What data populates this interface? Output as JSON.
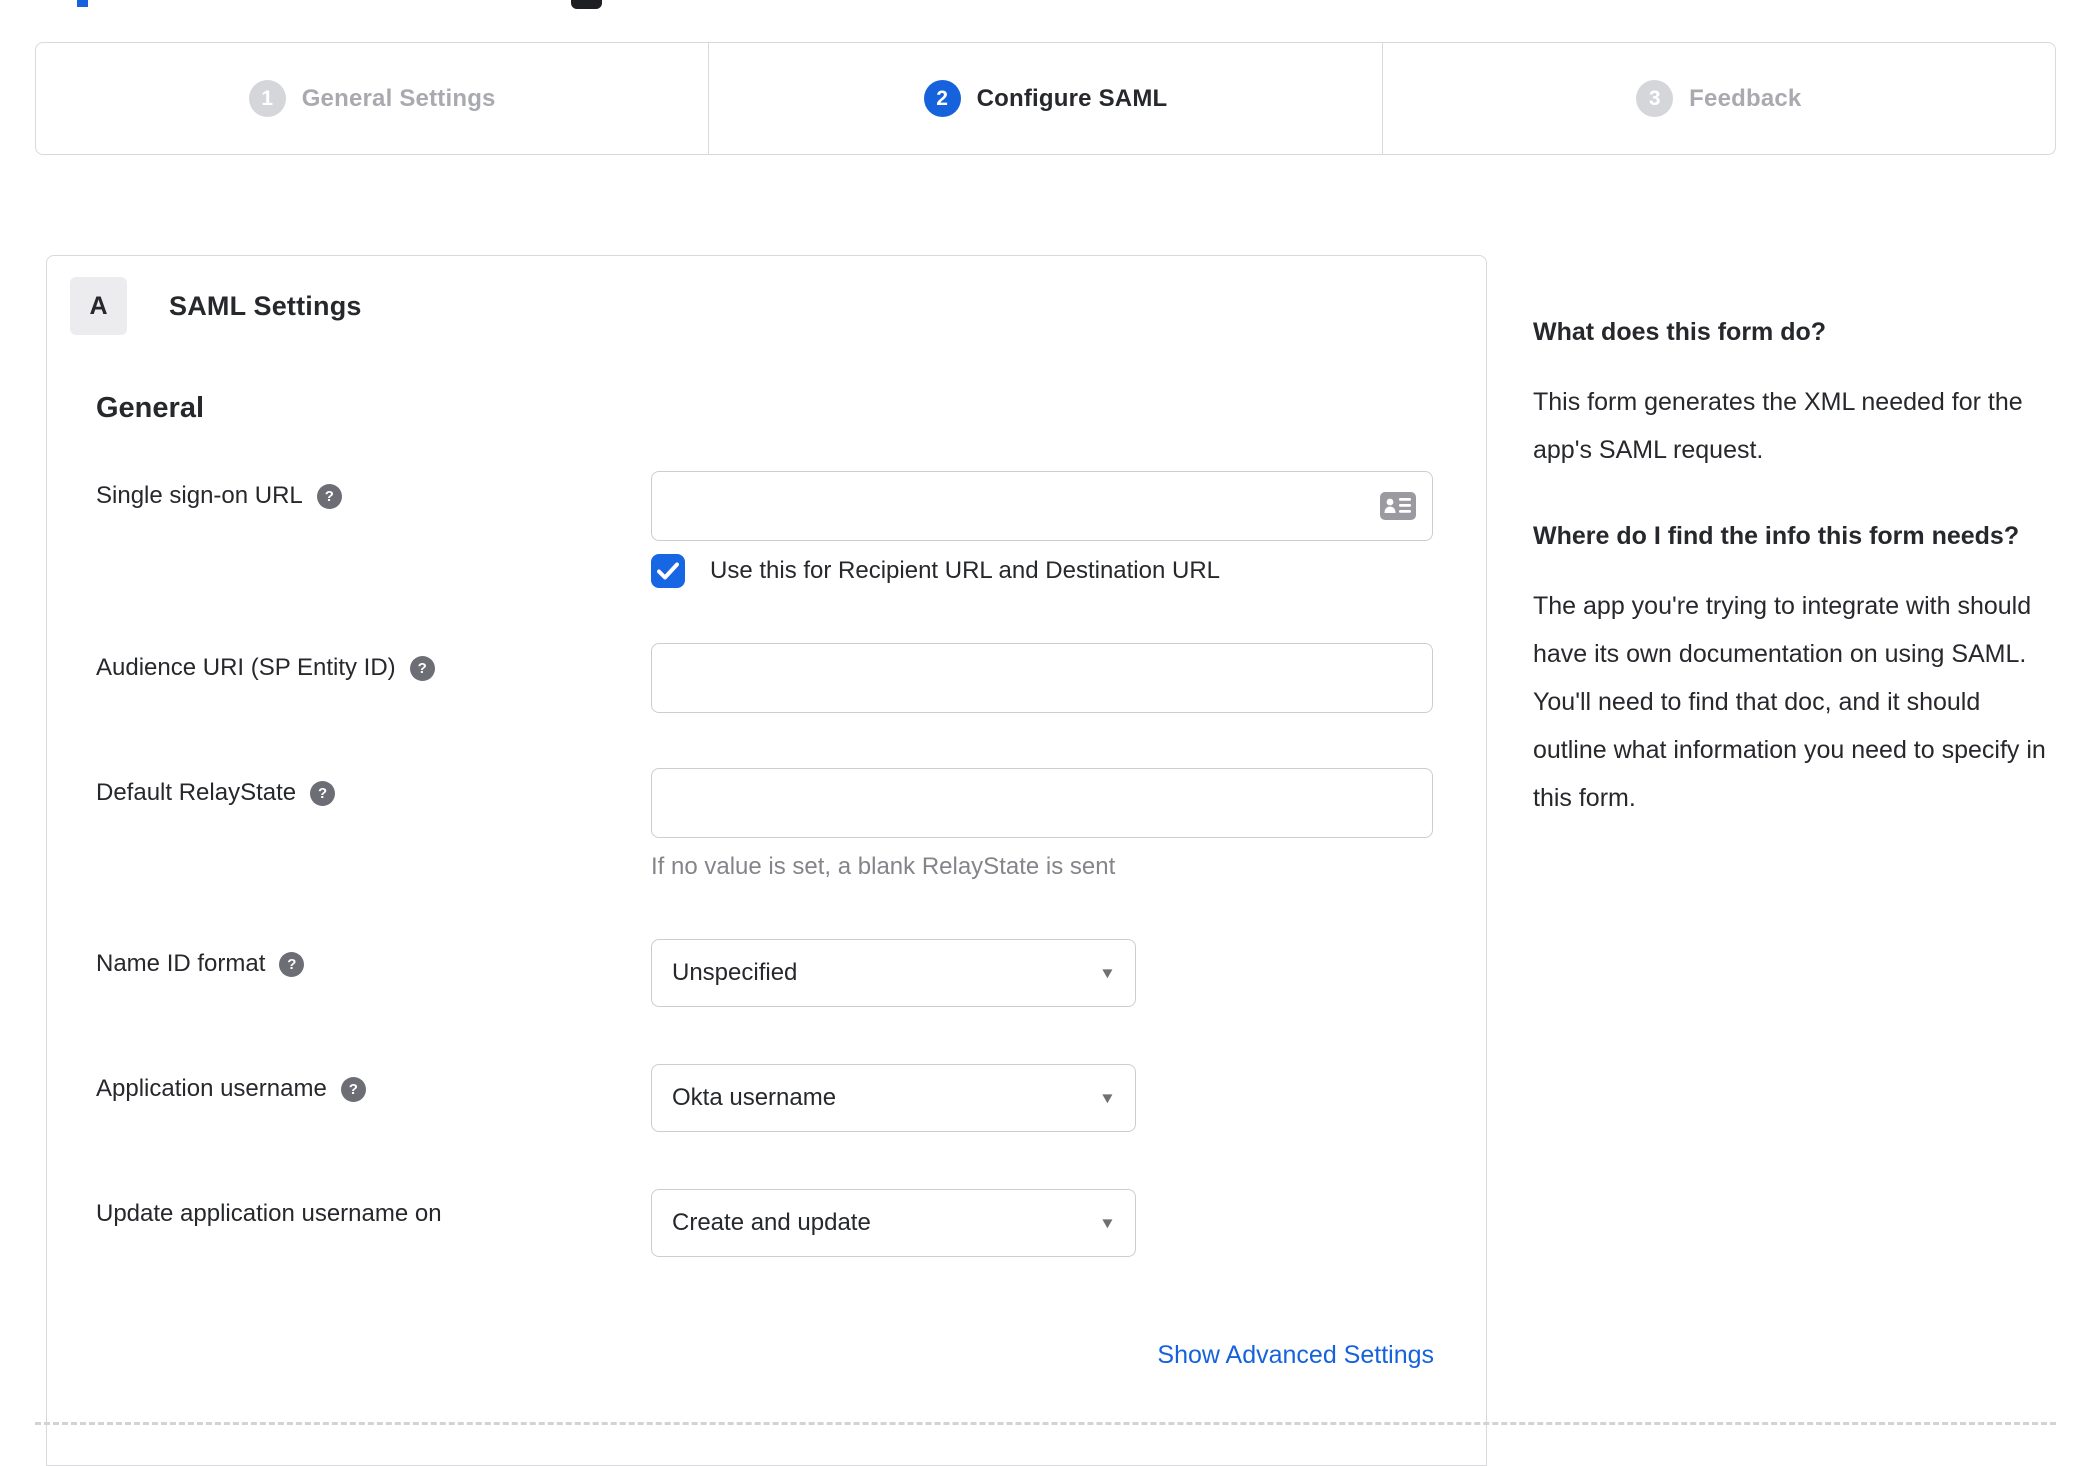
{
  "stepper": {
    "steps": [
      {
        "number": "1",
        "label": "General Settings",
        "state": "inactive"
      },
      {
        "number": "2",
        "label": "Configure SAML",
        "state": "active"
      },
      {
        "number": "3",
        "label": "Feedback",
        "state": "inactive"
      }
    ]
  },
  "panel": {
    "badge": "A",
    "title": "SAML Settings",
    "section_heading": "General",
    "fields": {
      "sso_url": {
        "label": "Single sign-on URL",
        "value": "",
        "placeholder": ""
      },
      "sso_checkbox": {
        "label": "Use this for Recipient URL and Destination URL",
        "checked": true
      },
      "audience": {
        "label": "Audience URI (SP Entity ID)",
        "value": "",
        "placeholder": ""
      },
      "relay": {
        "label": "Default RelayState",
        "value": "",
        "placeholder": "",
        "hint": "If no value is set, a blank RelayState is sent"
      },
      "name_id": {
        "label": "Name ID format",
        "value": "Unspecified"
      },
      "app_user": {
        "label": "Application username",
        "value": "Okta username"
      },
      "update_user": {
        "label": "Update application username on",
        "value": "Create and update"
      }
    },
    "advanced_link": "Show Advanced Settings"
  },
  "sidebar": {
    "sections": [
      {
        "heading": "What does this form do?",
        "body": "This form generates the XML needed for the app's SAML request."
      },
      {
        "heading": "Where do I find the info this form needs?",
        "body": "The app you're trying to integrate with should have its own documentation on using SAML. You'll need to find that doc, and it should outline what information you need to specify in this form."
      }
    ]
  },
  "icons": {
    "help": "?",
    "dropdown_caret": "▼",
    "checkbox_check": "checkmark",
    "contact_card": "contact-card"
  },
  "colors": {
    "accent_blue": "#1662dd",
    "checkbox_blue": "#1766e3",
    "link_blue": "#1662dd",
    "inactive_gray": "#d5d6d9",
    "inactive_text": "#a9aaaf",
    "border": "#d8d9dc",
    "input_border": "#cccdd2",
    "text": "#26282c",
    "hint_text": "#84858a",
    "help_icon_bg": "#6d6d75"
  }
}
